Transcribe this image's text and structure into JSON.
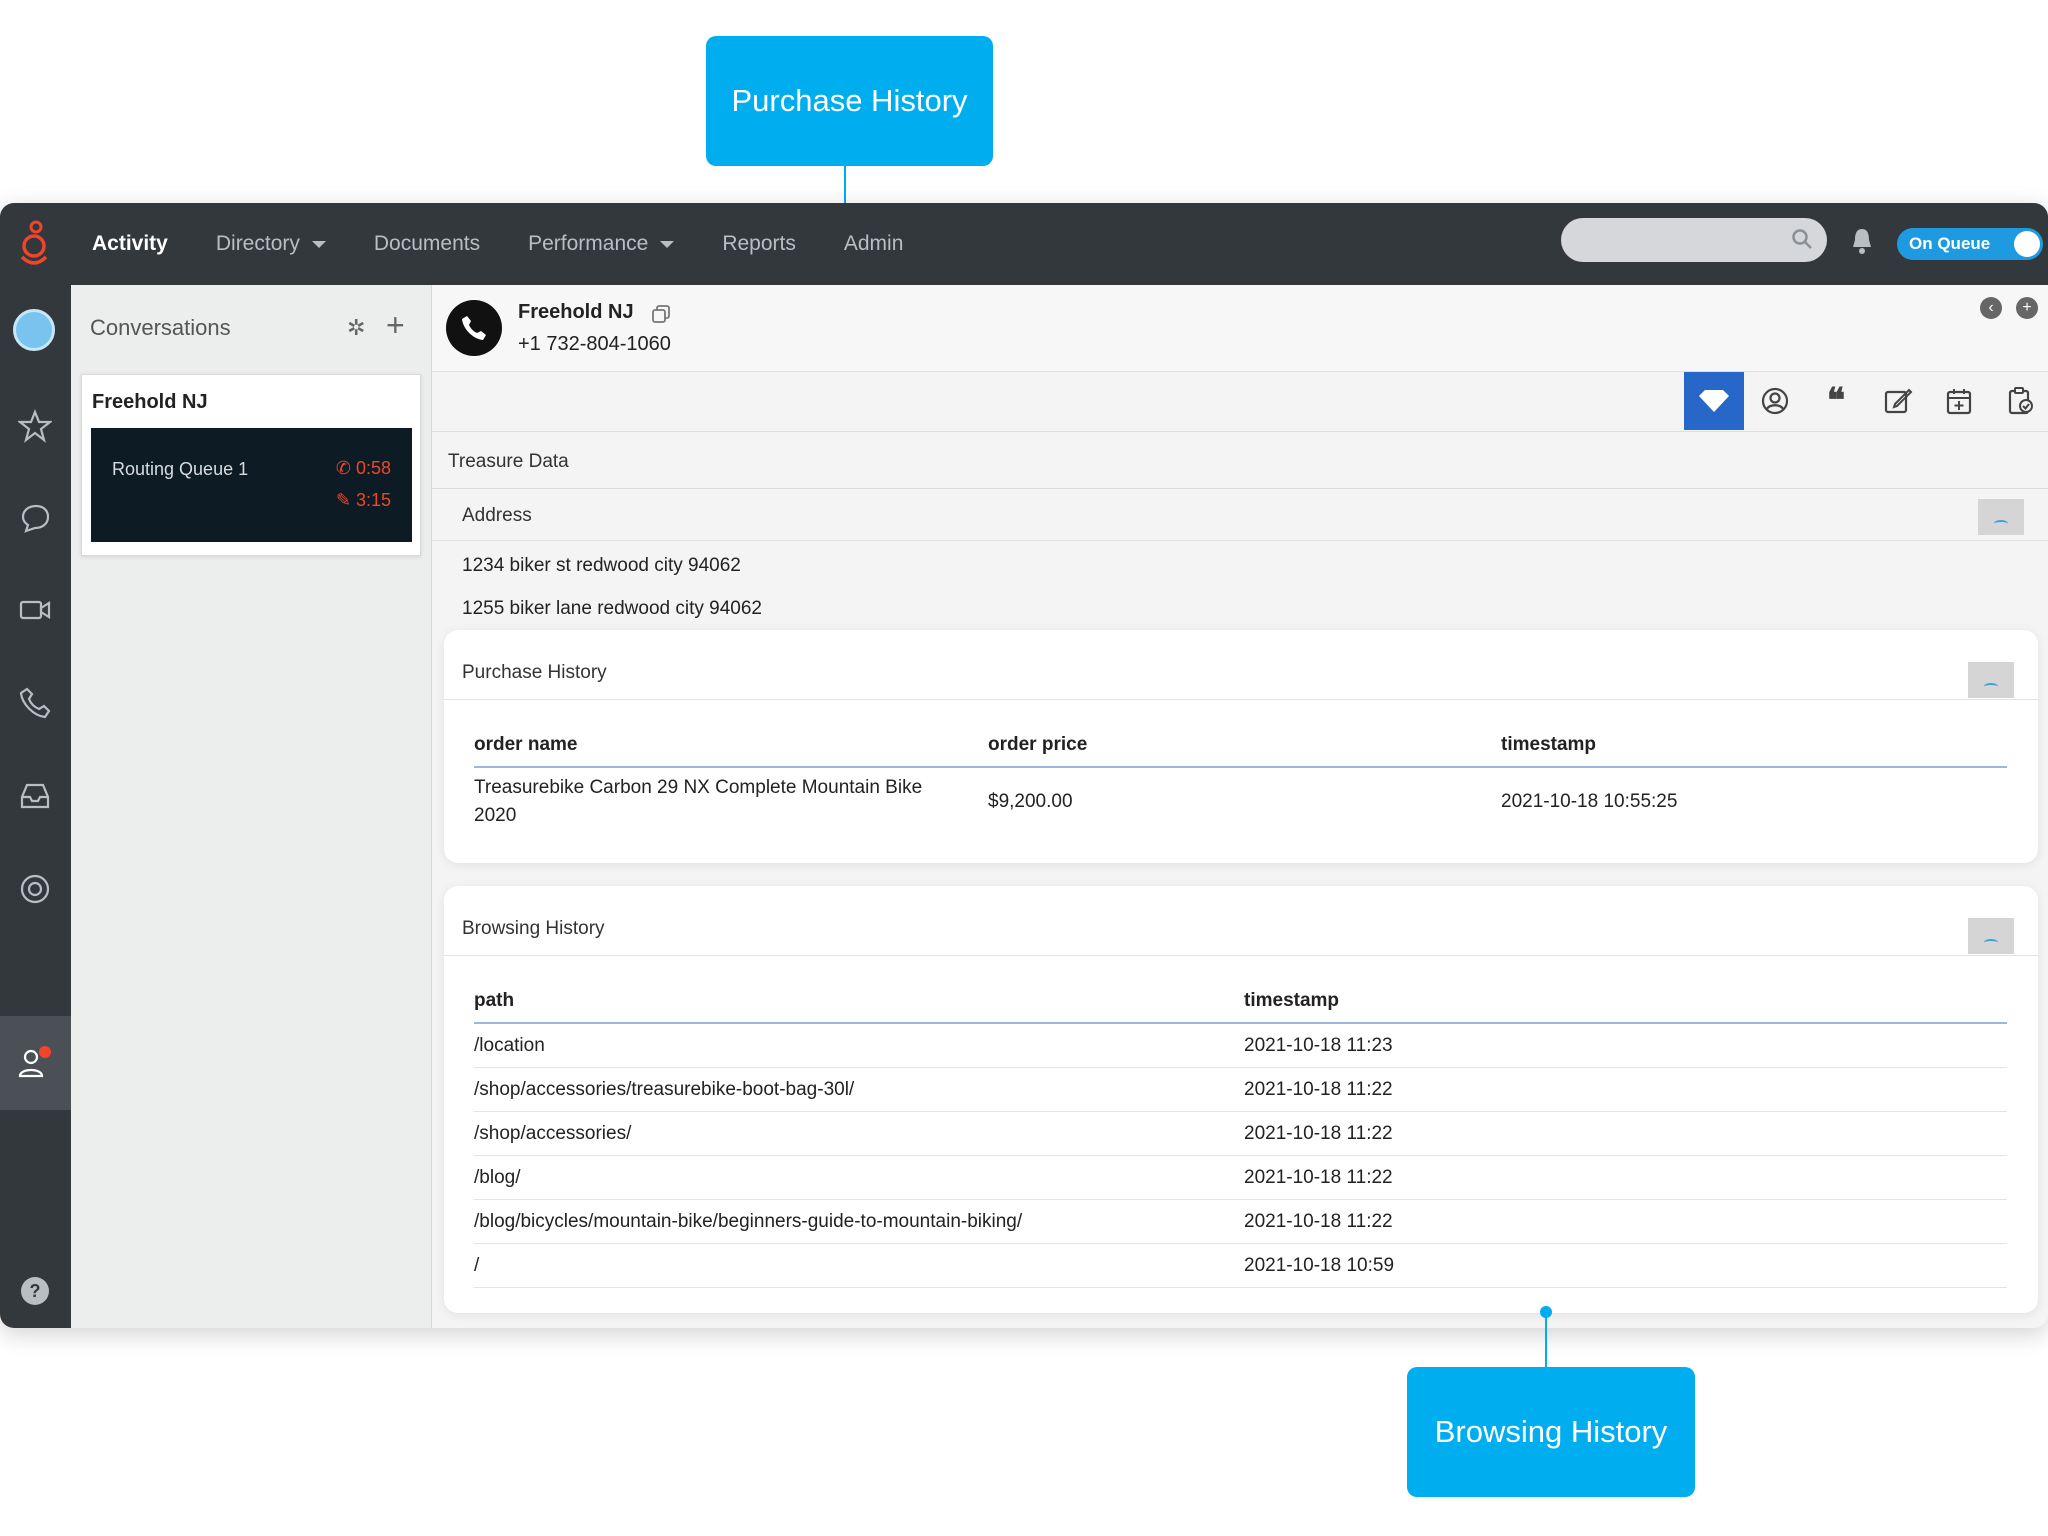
{
  "callouts": {
    "top": "Purchase History",
    "bottom": "Browsing History"
  },
  "nav": {
    "items": [
      {
        "label": "Activity",
        "active": true,
        "dropdown": false
      },
      {
        "label": "Directory",
        "active": false,
        "dropdown": true
      },
      {
        "label": "Documents",
        "active": false,
        "dropdown": false
      },
      {
        "label": "Performance",
        "active": false,
        "dropdown": true
      },
      {
        "label": "Reports",
        "active": false,
        "dropdown": false
      },
      {
        "label": "Admin",
        "active": false,
        "dropdown": false
      }
    ],
    "search_placeholder": "",
    "status_toggle": "On Queue"
  },
  "colors": {
    "accent": "#00aef0",
    "topbar": "#33383d",
    "toggle": "#1e9be0",
    "alert": "#f0452a",
    "active_tool": "#2767c9"
  },
  "conversations": {
    "title": "Conversations",
    "card": {
      "name": "Freehold NJ",
      "queue": "Routing Queue 1",
      "call_timer": "0:58",
      "wrap_timer": "3:15"
    }
  },
  "contact": {
    "name": "Freehold NJ",
    "phone": "+1 732-804-1060"
  },
  "treasure": {
    "title": "Treasure Data",
    "address": {
      "title": "Address",
      "lines": [
        "1234 biker st redwood city 94062",
        "1255 biker lane redwood city 94062"
      ]
    },
    "purchase_history": {
      "title": "Purchase History",
      "headers": [
        "order name",
        "order price",
        "timestamp"
      ],
      "rows": [
        {
          "order_name_1": "Treasurebike Carbon 29 NX Complete Mountain Bike",
          "order_name_2": "2020",
          "price": "$9,200.00",
          "timestamp": "2021-10-18 10:55:25"
        }
      ]
    },
    "browsing_history": {
      "title": "Browsing History",
      "headers": [
        "path",
        "timestamp"
      ],
      "rows": [
        {
          "path": "/location",
          "timestamp": "2021-10-18 11:23"
        },
        {
          "path": "/shop/accessories/treasurebike-boot-bag-30l/",
          "timestamp": "2021-10-18 11:22"
        },
        {
          "path": "/shop/accessories/",
          "timestamp": "2021-10-18 11:22"
        },
        {
          "path": "/blog/",
          "timestamp": "2021-10-18 11:22"
        },
        {
          "path": "/blog/bicycles/mountain-bike/beginners-guide-to-mountain-biking/",
          "timestamp": "2021-10-18 11:22"
        },
        {
          "path": "/",
          "timestamp": "2021-10-18 10:59"
        }
      ]
    }
  },
  "icons": {
    "rail": [
      "avatar",
      "star-icon",
      "chat-icon",
      "video-icon",
      "phone-icon",
      "inbox-icon",
      "support-icon",
      "agent-icon",
      "help-icon"
    ],
    "tools": [
      "gem-icon",
      "user-circle-icon",
      "quote-icon",
      "edit-icon",
      "calendar-add-icon",
      "clipboard-check-icon"
    ]
  }
}
